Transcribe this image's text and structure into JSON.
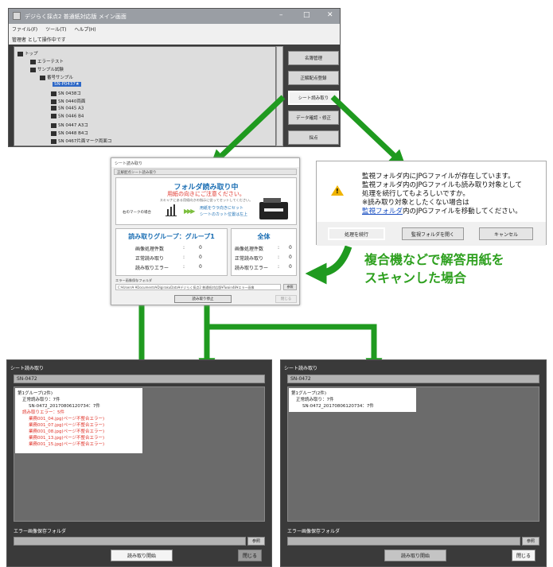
{
  "main_window": {
    "title": "デジらく採点2 普通紙対応版 メイン画面",
    "menu": [
      "ファイル(F)",
      "ツール(T)",
      "ヘルプ(H)"
    ],
    "status": "管理者 として操作中です",
    "tree": {
      "root": "トップ",
      "error_test": "エラーテスト",
      "sample_test": "サンプル試験",
      "bansample": "番号サンプル",
      "selected": "SN-P0437★",
      "items": [
        "SN 0438コ",
        "SN 0440両面",
        "SN 0445 A3",
        "SN 0446 B4",
        "SN 0447 A3コ",
        "SN 0448 B4コ",
        "SN 0467片面マーク両面コ"
      ]
    },
    "buttons": [
      "名簿管理",
      "正解配点登録",
      "シート読み取り",
      "データ確認・修正",
      "採点"
    ]
  },
  "read_dialog": {
    "title": "シート読み取り",
    "tab": "正解配点シート読み取り",
    "folder_heading": "フォルダ読み取り中",
    "orientation_warning": "用紙の向きにご注意ください。",
    "hint": "スキャナにある用紙向きの指示に従ってセットしてください。",
    "marker_label": "右のマークの場合",
    "paper_line1": "用紙をウラ向きにセット",
    "paper_line2": "シートのカット位置は左上",
    "group_title": "読み取りグループ：グループ1",
    "total_title": "全体",
    "stats_labels": [
      "画像処理件数",
      "正常読み取り",
      "読み取りエラー"
    ],
    "group_stats": [
      "0",
      "0",
      "0"
    ],
    "total_stats": [
      "0",
      "0",
      "0"
    ],
    "error_folder_label": "エラー画像保存フォルダ",
    "error_folder_path": "C:¥Users¥  ¥Documents¥DigirakuData¥デジらく採点2 普通紙対応版¥Twain48¥エラー画像",
    "ref_button": "参照",
    "start_button": "読み取り停止",
    "close_button": "閉じる"
  },
  "confirm_dialog": {
    "line1": "監視フォルダ内にJPGファイルが存在しています。",
    "line2": "監視フォルダ内のJPGファイルも読み取り対象として",
    "line3": "処理を続行してもよろしいですか。",
    "line4": "※読み取り対象としたくない場合は",
    "line5_link": "監視フォルダ",
    "line5_rest": "内のJPGファイルを移動してください。",
    "buttons": [
      "処理を続行",
      "監視フォルダを開く",
      "キャンセル"
    ]
  },
  "annotation": {
    "line1": "複合機などで解答用紙を",
    "line2": "スキャンした場合"
  },
  "result_left": {
    "title": "シート読み取り",
    "sn": "SN-0472",
    "group": "第1グループ(2件)",
    "normal": "正常読み取り：7件",
    "normal_item": "SN-0472_20170806120734：7件",
    "error": "読み取りエラー：5件",
    "error_items": [
      "業務001_04.jpg(ページ不整合エラー)",
      "業務001_07.jpg(ページ不整合エラー)",
      "業務001_08.jpg(ページ不整合エラー)",
      "業務001_13.jpg(ページ不整合エラー)",
      "業務001_15.jpg(ページ不整合エラー)"
    ],
    "error_folder_label": "エラー画像保存フォルダ",
    "ref_button": "参照",
    "start_button": "読み取り開始",
    "close_button": "閉じる"
  },
  "result_right": {
    "title": "シート読み取り",
    "sn": "SN-0472",
    "group": "第1グループ(2件)",
    "normal": "正常読み取り：7件",
    "normal_item": "SN-0472_20170806120734：7件",
    "error_folder_label": "エラー画像保存フォルダ",
    "ref_button": "参照",
    "start_button": "読み取り開始",
    "close_button": "閉じる"
  },
  "colors": {
    "arrow": "#1f9a1f",
    "annotation": "#2ea01f",
    "accent_blue": "#1c6fb4",
    "error_red": "#e0342b"
  }
}
